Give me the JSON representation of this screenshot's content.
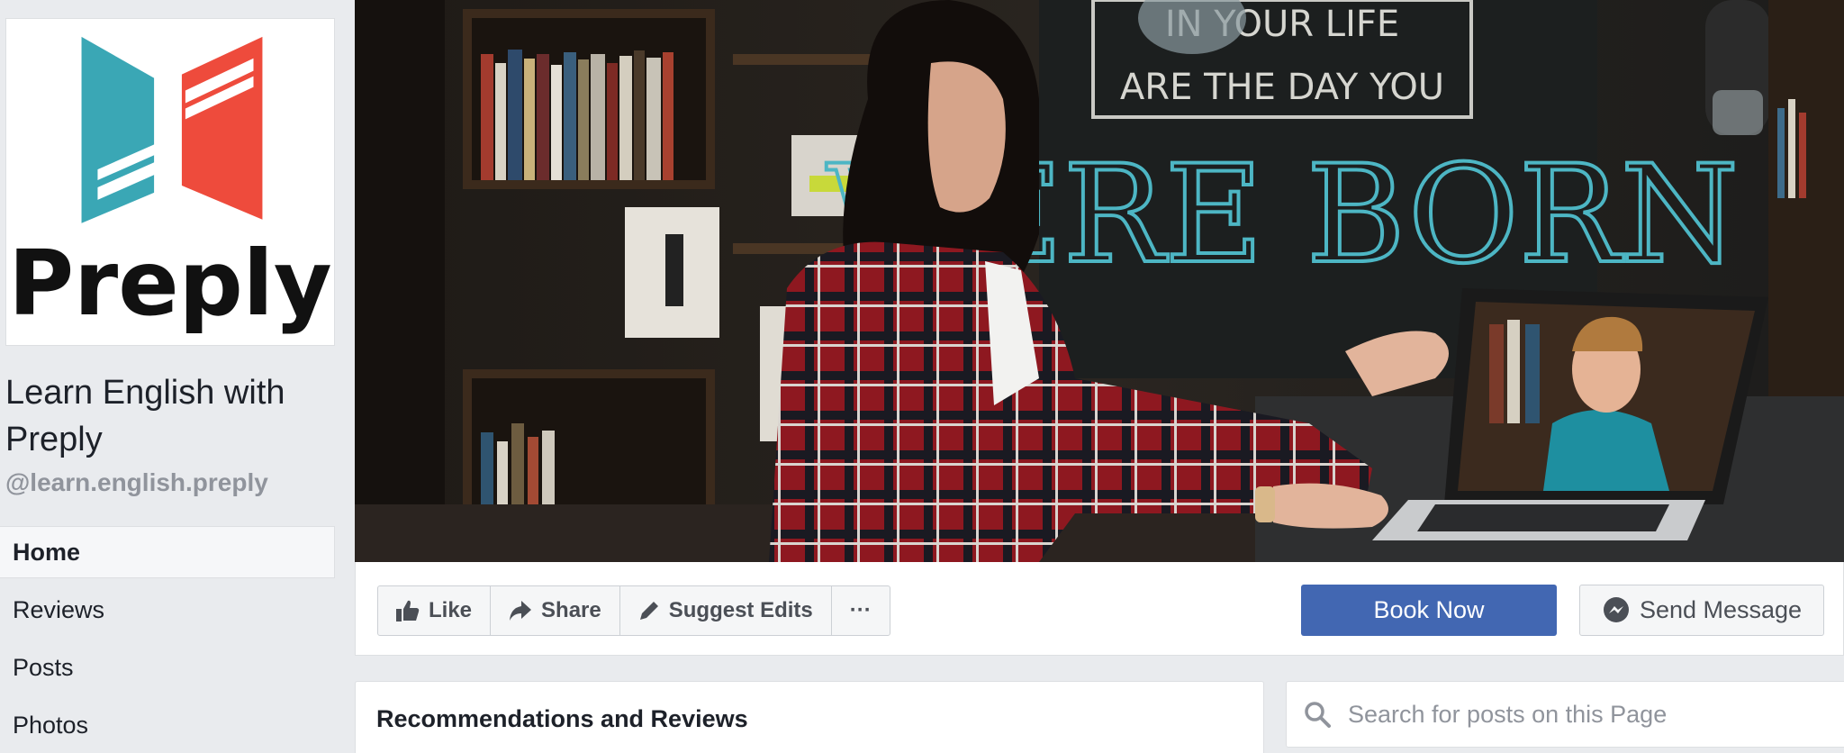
{
  "page": {
    "name": "Learn English with Preply",
    "handle": "@learn.english.preply",
    "logo_text": "Preply"
  },
  "nav": {
    "items": [
      {
        "label": "Home",
        "active": true
      },
      {
        "label": "Reviews",
        "active": false
      },
      {
        "label": "Posts",
        "active": false
      },
      {
        "label": "Photos",
        "active": false
      }
    ]
  },
  "cover": {
    "chalkboard_lines": [
      "IN YOUR LIFE",
      "ARE THE DAY YOU",
      "WERE BORN"
    ]
  },
  "actions": {
    "like_label": "Like",
    "share_label": "Share",
    "suggest_label": "Suggest Edits",
    "more_label": "···",
    "book_label": "Book Now",
    "message_label": "Send Message"
  },
  "reviews_card": {
    "title": "Recommendations and Reviews"
  },
  "search": {
    "placeholder": "Search for posts on this Page"
  },
  "colors": {
    "primary_button": "#4267b2",
    "logo_teal": "#3aa7b5",
    "logo_red": "#ee4b3c",
    "background": "#e9ebee"
  },
  "icons": [
    "thumbs-up-icon",
    "share-arrow-icon",
    "pencil-icon",
    "more-icon",
    "messenger-icon",
    "search-icon"
  ]
}
